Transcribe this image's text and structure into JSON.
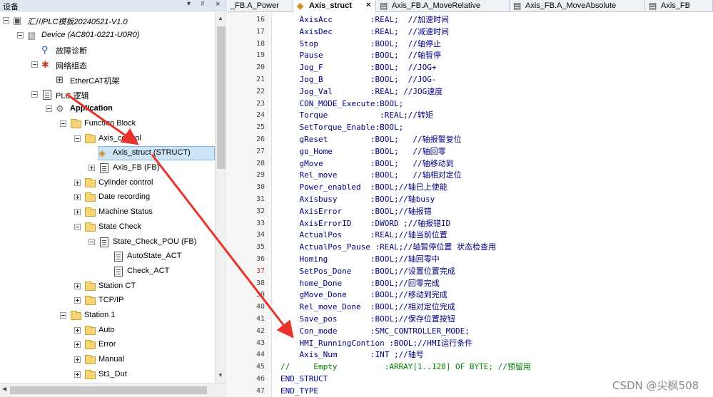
{
  "pane": {
    "title": "设备",
    "pin": "▾",
    "pin2": "ᵖ",
    "close": "×"
  },
  "tree": [
    {
      "label": "汇川PLC模板20240521-V1.0",
      "level": 0,
      "icon": "project-icon",
      "expander": "minus",
      "italic": true
    },
    {
      "label": "Device (AC801-0221-U0R0)",
      "level": 1,
      "icon": "device-icon",
      "expander": "minus",
      "italic": true
    },
    {
      "label": "故障诊断",
      "level": 2,
      "icon": "diagnose-icon",
      "expander": "none"
    },
    {
      "label": "网络组态",
      "level": 2,
      "icon": "network-icon",
      "expander": "minus"
    },
    {
      "label": "EtherCAT机架",
      "level": 3,
      "icon": "rack-icon",
      "expander": "none"
    },
    {
      "label": "PLC 逻辑",
      "level": 2,
      "icon": "plc-logic-icon",
      "expander": "minus"
    },
    {
      "label": "Application",
      "level": 3,
      "icon": "application-icon",
      "expander": "minus",
      "bold": true
    },
    {
      "label": "Function Block",
      "level": 4,
      "icon": "folder-icon",
      "expander": "minus"
    },
    {
      "label": "Axis_control",
      "level": 5,
      "icon": "folder-icon",
      "expander": "minus"
    },
    {
      "label": "Axis_struct (STRUCT)",
      "level": 6,
      "icon": "struct-icon",
      "expander": "none",
      "selected": true
    },
    {
      "label": "Axis_FB (FB)",
      "level": 6,
      "icon": "fb-icon",
      "expander": "plus"
    },
    {
      "label": "Cylinder control",
      "level": 5,
      "icon": "folder-icon",
      "expander": "plus"
    },
    {
      "label": "Date  recording",
      "level": 5,
      "icon": "folder-icon",
      "expander": "plus"
    },
    {
      "label": "Machine Status",
      "level": 5,
      "icon": "folder-icon",
      "expander": "plus"
    },
    {
      "label": "State Check",
      "level": 5,
      "icon": "folder-icon",
      "expander": "minus"
    },
    {
      "label": "State_Check_POU (FB)",
      "level": 6,
      "icon": "fb-icon",
      "expander": "minus"
    },
    {
      "label": "AutoState_ACT",
      "level": 7,
      "icon": "action-icon",
      "expander": "none"
    },
    {
      "label": "Check_ACT",
      "level": 7,
      "icon": "action-icon",
      "expander": "none"
    },
    {
      "label": "Station CT",
      "level": 5,
      "icon": "folder-icon",
      "expander": "plus"
    },
    {
      "label": "TCP/IP",
      "level": 5,
      "icon": "folder-icon",
      "expander": "plus"
    },
    {
      "label": "Station 1",
      "level": 4,
      "icon": "folder-icon",
      "expander": "minus"
    },
    {
      "label": "Auto",
      "level": 5,
      "icon": "folder-icon",
      "expander": "plus"
    },
    {
      "label": "Error",
      "level": 5,
      "icon": "folder-icon",
      "expander": "plus"
    },
    {
      "label": "Manual",
      "level": 5,
      "icon": "folder-icon",
      "expander": "plus"
    },
    {
      "label": "St1_Dut",
      "level": 5,
      "icon": "folder-icon",
      "expander": "plus"
    }
  ],
  "tabs": [
    {
      "label": "_FB.A_Power",
      "icon": "",
      "active": false
    },
    {
      "label": "Axis_struct",
      "icon": "struct-icon",
      "active": true,
      "close": "×"
    },
    {
      "label": "Axis_FB.A_MoveRelative",
      "icon": "doc-icon",
      "active": false
    },
    {
      "label": "Axis_FB.A_MoveAbsolute",
      "icon": "doc-icon",
      "active": false
    },
    {
      "label": "Axis_FB",
      "icon": "doc-icon",
      "active": false
    }
  ],
  "code_lines": [
    {
      "n": "16",
      "text": "    AxisAcc        :REAL;  //加速时间"
    },
    {
      "n": "17",
      "text": "    AxisDec        :REAL;  //减速时间"
    },
    {
      "n": "18",
      "text": "    Stop           :BOOL;  //轴停止"
    },
    {
      "n": "19",
      "text": "    Pause          :BOOL;  //轴暂停"
    },
    {
      "n": "20",
      "text": "    Jog_F          :BOOL;  //JOG+"
    },
    {
      "n": "21",
      "text": "    Jog_B          :BOOL;  //JOG-"
    },
    {
      "n": "22",
      "text": "    Jog_Val        :REAL; //JOG速度"
    },
    {
      "n": "23",
      "text": "    CON_MODE_Execute:BOOL;"
    },
    {
      "n": "24",
      "text": "    Torque           :REAL;//转矩"
    },
    {
      "n": "25",
      "text": "    SetTorque_Enable:BOOL;"
    },
    {
      "n": "26",
      "text": "    gReset         :BOOL;   //轴报警复位"
    },
    {
      "n": "27",
      "text": "    go_Home        :BOOL;   //轴回零"
    },
    {
      "n": "28",
      "text": "    gMove          :BOOL;   //轴移动到"
    },
    {
      "n": "29",
      "text": "    Rel_move       :BOOL;   //轴相对定位"
    },
    {
      "n": "30",
      "text": "    Power_enabled  :BOOL;//轴已上使能"
    },
    {
      "n": "31",
      "text": "    Axisbusy       :BOOL;//轴busy"
    },
    {
      "n": "32",
      "text": "    AxisError      :BOOL;//轴报错"
    },
    {
      "n": "33",
      "text": "    AxisErrorID    :DWORD ;//轴报错ID"
    },
    {
      "n": "34",
      "text": "    ActualPos      :REAL;//轴当前位置"
    },
    {
      "n": "35",
      "text": "    ActualPos_Pause :REAL;//轴暂停位置 状态检查用"
    },
    {
      "n": "36",
      "text": "    Homing         :BOOL;//轴回零中"
    },
    {
      "n": "37",
      "text": "    SetPos_Done    :BOOL;//设置位置完成"
    },
    {
      "n": "38",
      "text": "    home_Done      :BOOL;//回零完成"
    },
    {
      "n": "39",
      "text": "    gMove_Done     :BOOL;//移动到完成"
    },
    {
      "n": "40",
      "text": "    Rel_move_Done  :BOOL;//相对定位完成"
    },
    {
      "n": "41",
      "text": "    Save_pos       :BOOL;//保存位置按钮"
    },
    {
      "n": "42",
      "text": "    Con_mode       :SMC_CONTROLLER_MODE;"
    },
    {
      "n": "43",
      "text": "    HMI_RunningContion :BOOL;//HMI运行条件"
    },
    {
      "n": "44",
      "text": "    Axis_Num       :INT ;//轴号"
    },
    {
      "n": "45",
      "text": "//     Empty          :ARRAY[1..128] OF BYTE; //预留用"
    },
    {
      "n": "46",
      "text": "END_STRUCT"
    },
    {
      "n": "47",
      "text": "END_TYPE"
    }
  ],
  "watermark": "CSDN @尖枫508",
  "colors": {
    "arrow": "#e8322b",
    "selection": "#cde5f7",
    "comment": "#008000",
    "code": "#000080"
  }
}
